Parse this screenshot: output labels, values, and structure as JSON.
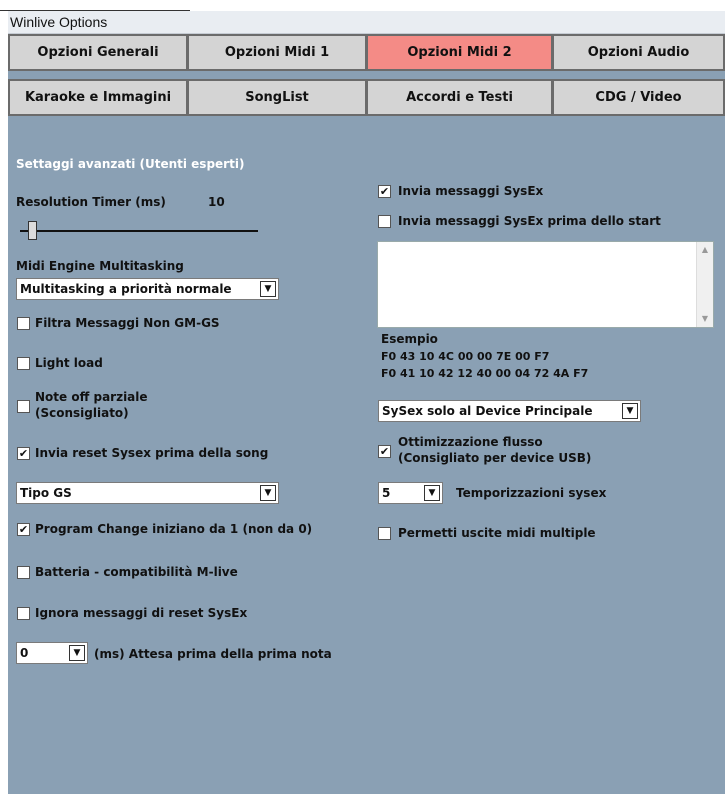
{
  "window": {
    "title": "Winlive  Options"
  },
  "tabs": [
    {
      "label": "Opzioni Generali"
    },
    {
      "label": "Opzioni Midi 1"
    },
    {
      "label": "Opzioni Midi 2"
    },
    {
      "label": "Opzioni Audio"
    },
    {
      "label": "Karaoke e Immagini"
    },
    {
      "label": "SongList"
    },
    {
      "label": "Accordi e Testi"
    },
    {
      "label": "CDG / Video"
    }
  ],
  "active_tab": "Opzioni Midi 2",
  "left": {
    "section_title": "Settaggi avanzati (Utenti esperti)",
    "resolution_timer": {
      "label": "Resolution Timer (ms)",
      "value": "10"
    },
    "midi_engine": {
      "label": "Midi Engine Multitasking",
      "selected": "Multitasking a priorità normale"
    },
    "filtra": {
      "label": "Filtra Messaggi Non GM-GS",
      "checked": false
    },
    "light_load": {
      "label": "Light load",
      "checked": false
    },
    "note_off": {
      "line1": "Note off parziale",
      "line2": "(Sconsigliato)",
      "checked": false
    },
    "invia_reset": {
      "label": "Invia reset Sysex prima della song",
      "checked": true
    },
    "tipo": {
      "selected": "Tipo GS"
    },
    "program_change": {
      "label": "Program Change iniziano da 1 (non da 0)",
      "checked": true
    },
    "batteria": {
      "label": "Batteria - compatibilità M-live",
      "checked": false
    },
    "ignora": {
      "label": "Ignora messaggi di reset SysEx",
      "checked": false
    },
    "attesa": {
      "selected": "0",
      "label": "(ms) Attesa prima della prima nota"
    }
  },
  "right": {
    "invia_sysex": {
      "label": "Invia messaggi SysEx",
      "checked": true
    },
    "invia_sysex_start": {
      "label": "Invia messaggi SysEx prima dello start",
      "checked": false
    },
    "sysex_text": "",
    "example": {
      "title": "Esempio",
      "line1": "F0 43 10 4C 00 00 7E 00 F7",
      "line2": "F0 41 10 42 12 40 00 04 72 4A F7"
    },
    "device": {
      "selected": "SySex solo al Device Principale"
    },
    "ottimizzazione": {
      "line1": "Ottimizzazione flusso",
      "line2": "(Consigliato per device USB)",
      "checked": true
    },
    "temporizzazioni": {
      "selected": "5",
      "label": "Temporizzazioni sysex"
    },
    "permetti": {
      "label": "Permetti uscite midi multiple",
      "checked": false
    }
  },
  "checkmark": "✔",
  "dropdown_arrow": "▼",
  "colors": {
    "panel": "#8aa0b4",
    "active_tab": "#f48b86",
    "tab": "#d4d4d4"
  }
}
